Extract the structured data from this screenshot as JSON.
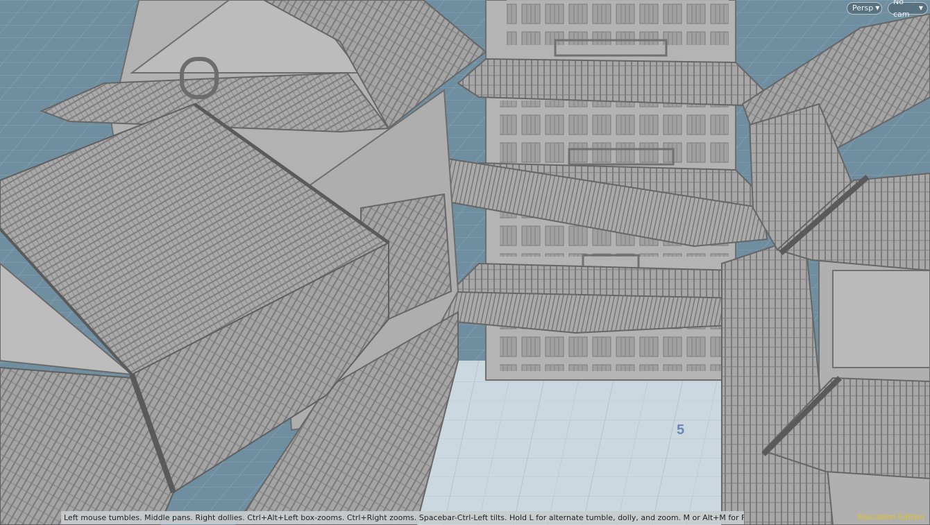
{
  "viewport": {
    "projection_menu": {
      "label": "Persp"
    },
    "camera_menu": {
      "label": "No cam"
    },
    "grid_number_label": "5",
    "hint_text": "Left mouse tumbles. Middle pans. Right dollies. Ctrl+Alt+Left box-zooms. Ctrl+Right zooms. Spacebar-Ctrl-Left tilts. Hold L for alternate tumble, dolly, and zoom. M or Alt+M for First Person Navigation.",
    "edition_label": "Education Edition"
  },
  "icons": {
    "dropdown": "chevron-down-icon"
  },
  "colors": {
    "background": "#6f8ea0",
    "grid_floor": "#c9d6dd",
    "model_shading": "#a6a6a6",
    "edition_text": "#e3c31a"
  }
}
